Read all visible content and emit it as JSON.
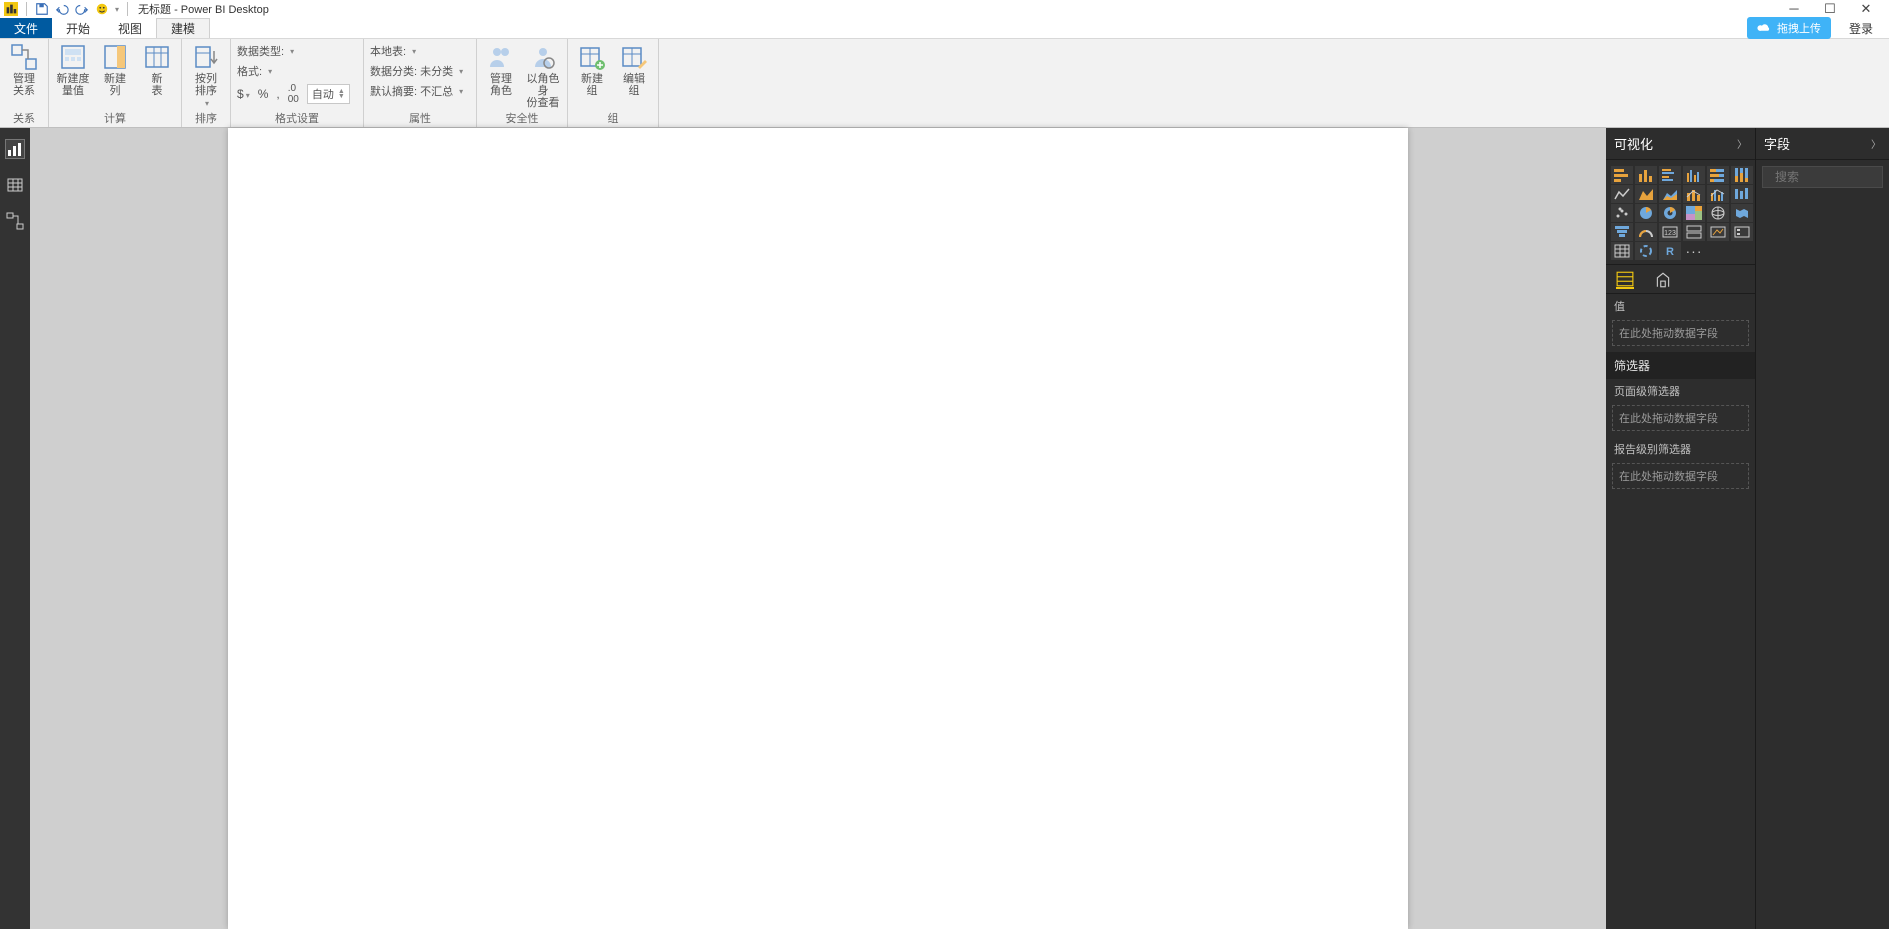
{
  "title": "无标题 - Power BI Desktop",
  "tabs": {
    "file": "文件",
    "home": "开始",
    "view": "视图",
    "model": "建模"
  },
  "topright": {
    "upload": "拖拽上传",
    "login": "登录"
  },
  "ribbon": {
    "relations": {
      "label": "关系",
      "manage": "管理\n关系"
    },
    "calc": {
      "label": "计算",
      "newMeasure": "新建度\n量值",
      "newColumn": "新建\n列",
      "newTable": "新\n表"
    },
    "sort": {
      "label": "排序",
      "sortBy": "按列\n排序"
    },
    "format": {
      "label": "格式设置",
      "dataType": "数据类型:",
      "fmt": "格式:",
      "auto": "自动"
    },
    "props": {
      "label": "属性",
      "homeTable": "本地表:",
      "dataCat": "数据分类: 未分类",
      "defaultAgg": "默认摘要: 不汇总"
    },
    "security": {
      "label": "安全性",
      "manageRoles": "管理\n角色",
      "viewAs": "以角色身\n份查看"
    },
    "groups": {
      "label": "组",
      "newGroup": "新建\n组",
      "editGroup": "编辑\n组"
    }
  },
  "viz": {
    "header": "可视化",
    "value": "值",
    "dropHint": "在此处拖动数据字段",
    "filters": "筛选器",
    "pageFilter": "页面级筛选器",
    "reportFilter": "报告级别筛选器"
  },
  "fields": {
    "header": "字段",
    "searchPlaceholder": "搜索"
  }
}
